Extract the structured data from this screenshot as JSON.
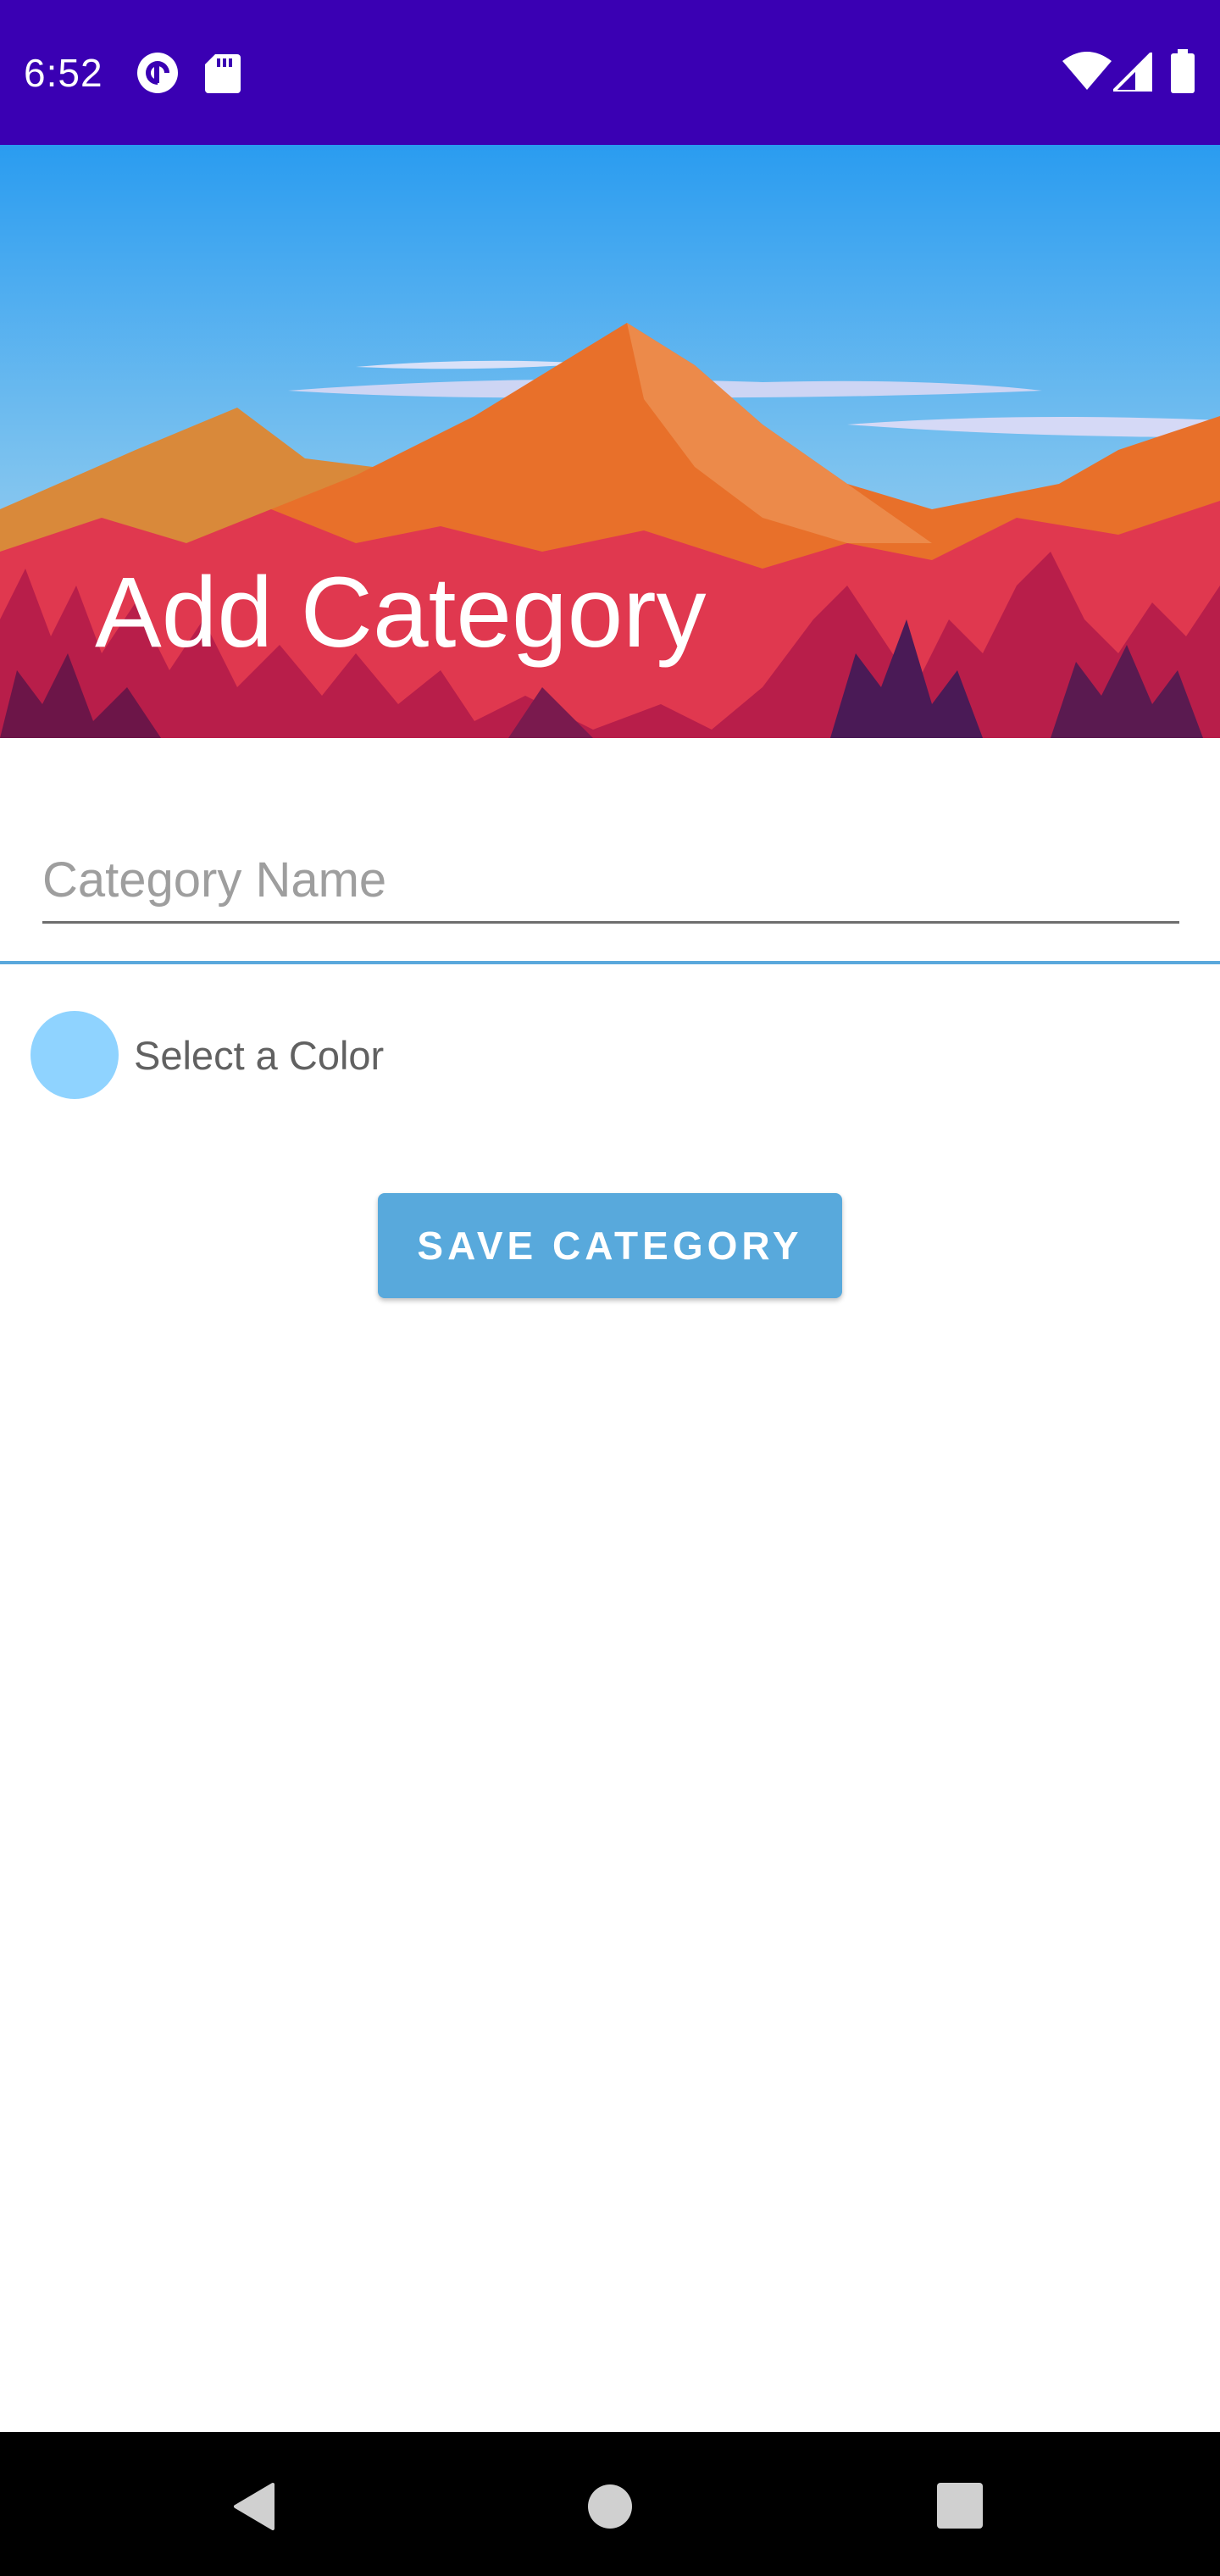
{
  "status_bar": {
    "time": "6:52",
    "background_color": "#3a00b3",
    "left_icons": [
      "pocket-casts-icon",
      "sd-card-icon"
    ],
    "right_icons": [
      "wifi-icon",
      "cell-signal-icon",
      "battery-icon"
    ]
  },
  "header": {
    "title": "Add Category",
    "image": "mountain-landscape-illustration"
  },
  "form": {
    "category_name": {
      "value": "",
      "placeholder": "Category Name"
    },
    "color_picker": {
      "label": "Select a Color",
      "selected_color": "#8fd3ff"
    },
    "save_button": {
      "label": "SAVE CATEGORY",
      "color": "#58a9dc"
    }
  },
  "nav_bar": {
    "buttons": [
      "back-icon",
      "home-icon",
      "recents-icon"
    ]
  }
}
